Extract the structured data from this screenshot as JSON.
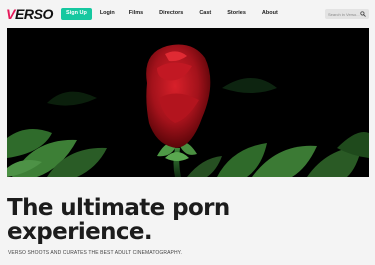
{
  "header": {
    "logo": {
      "first_letter": "V",
      "rest": "ERSO"
    },
    "signup_label": "Sign Up",
    "nav": [
      "Login",
      "Films",
      "Directors",
      "Cast",
      "Stories",
      "About"
    ],
    "search": {
      "placeholder": "Search in Verso..."
    }
  },
  "hero": {
    "image": "red-flower-in-dark-foliage"
  },
  "main": {
    "headline_line1": "The ultimate porn",
    "headline_line2": "experience.",
    "tagline": "VERSO SHOOTS AND CURATES THE BEST ADULT CINEMATOGRAPHY."
  },
  "colors": {
    "brand_pink": "#e6195a",
    "signup_teal": "#16c8a0",
    "background": "#f4f4f4"
  }
}
